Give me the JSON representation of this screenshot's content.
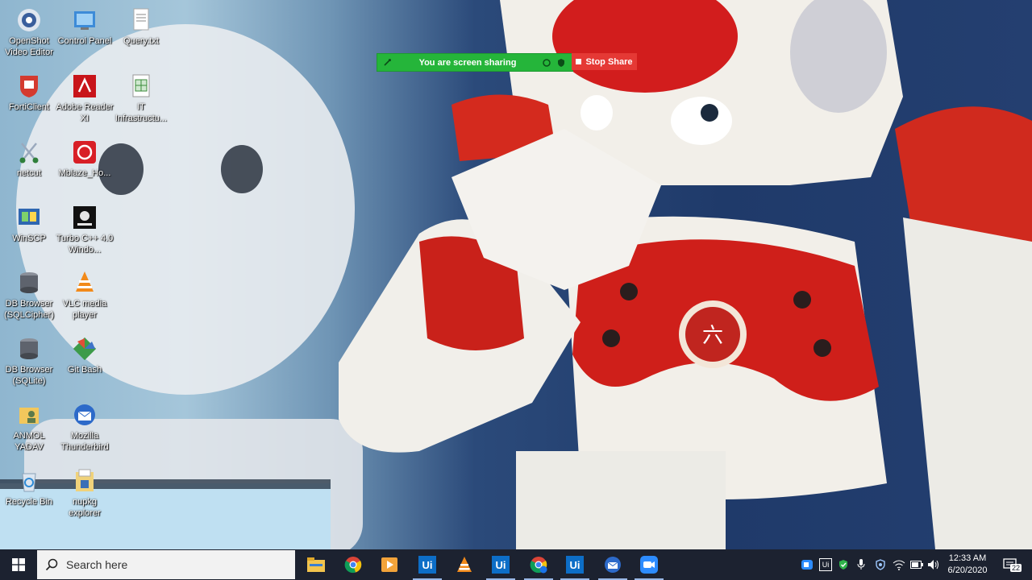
{
  "desktop": {
    "icons": [
      {
        "label": "OpenShot Video Editor",
        "icon": "openshot-icon"
      },
      {
        "label": "Control Panel",
        "icon": "control-panel-icon"
      },
      {
        "label": "Query.txt",
        "icon": "text-file-icon"
      },
      {
        "label": "FortiClient",
        "icon": "forticlient-icon"
      },
      {
        "label": "Adobe Reader XI",
        "icon": "adobe-reader-icon"
      },
      {
        "label": "IT Infrastructu...",
        "icon": "spreadsheet-file-icon"
      },
      {
        "label": "netcut",
        "icon": "netcut-icon"
      },
      {
        "label": "Mblaze_Ho...",
        "icon": "mblaze-icon"
      },
      {
        "label": "WinSCP",
        "icon": "winscp-icon"
      },
      {
        "label": "Turbo C++ 4.0 Windo...",
        "icon": "turbo-c-icon"
      },
      {
        "label": "DB Browser (SQLCipher)",
        "icon": "db-browser-icon"
      },
      {
        "label": "VLC media player",
        "icon": "vlc-icon"
      },
      {
        "label": "DB Browser (SQLite)",
        "icon": "db-browser-icon"
      },
      {
        "label": "Git Bash",
        "icon": "git-bash-icon"
      },
      {
        "label": "ANMOL YADAV",
        "icon": "user-folder-icon"
      },
      {
        "label": "Mozilla Thunderbird",
        "icon": "thunderbird-icon"
      },
      {
        "label": "Recycle Bin",
        "icon": "recycle-bin-icon"
      },
      {
        "label": "nupkg explorer",
        "icon": "nupkg-explorer-icon"
      }
    ]
  },
  "screen_share": {
    "status_text": "You are screen sharing",
    "stop_label": "Stop Share",
    "bar_color": "#25b53a",
    "stop_color": "#e53935"
  },
  "taskbar": {
    "search_placeholder": "Search here",
    "apps": [
      {
        "name": "file-explorer-icon"
      },
      {
        "name": "chrome-icon"
      },
      {
        "name": "media-player-icon"
      },
      {
        "name": "uipath-studio-icon",
        "text": "Ui"
      },
      {
        "name": "vlc-icon"
      },
      {
        "name": "uipath-robot-icon",
        "text": "Ui"
      },
      {
        "name": "chrome-profile-icon"
      },
      {
        "name": "uipath-assistant-icon",
        "text": "Ui"
      },
      {
        "name": "thunderbird-icon"
      },
      {
        "name": "zoom-icon"
      }
    ],
    "clock_time": "12:33 AM",
    "clock_date": "6/20/2020",
    "notification_count": "22",
    "tray_ui_text": "Ui"
  }
}
